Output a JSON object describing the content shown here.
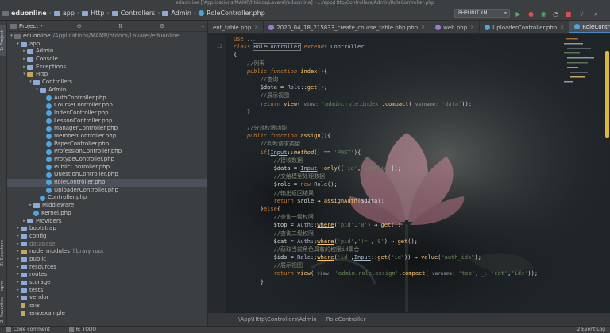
{
  "window": {
    "title": "eduonline [/Applications/MAMP/htdocs/Lavarel/eduonline] - .../app/Http/Controllers/Admin/RoleController.php"
  },
  "navbar": {
    "breadcrumbs": [
      "eduonline",
      "app",
      "Http",
      "Controllers",
      "Admin",
      "RoleController.php"
    ],
    "run_config": "PHPUNIT.XML"
  },
  "project_panel": {
    "title": "Project",
    "tree": [
      {
        "label": "eduonline",
        "path": "/Applications/MAMP/htdocs/Lavarel/eduonline",
        "type": "root"
      },
      {
        "label": "app",
        "type": "folder"
      },
      {
        "label": "Admin",
        "type": "folder"
      },
      {
        "label": "Console",
        "type": "folder"
      },
      {
        "label": "Exceptions",
        "type": "folder"
      },
      {
        "label": "Http",
        "type": "folder"
      },
      {
        "label": "Controllers",
        "type": "folder"
      },
      {
        "label": "Admin",
        "type": "folder"
      },
      {
        "label": "AuthController.php",
        "type": "php"
      },
      {
        "label": "CourseController.php",
        "type": "php"
      },
      {
        "label": "IndexController.php",
        "type": "php"
      },
      {
        "label": "LessonController.php",
        "type": "php"
      },
      {
        "label": "ManagerController.php",
        "type": "php"
      },
      {
        "label": "MemberController.php",
        "type": "php"
      },
      {
        "label": "PaperController.php",
        "type": "php"
      },
      {
        "label": "ProfessionController.php",
        "type": "php"
      },
      {
        "label": "ProtypeController.php",
        "type": "php"
      },
      {
        "label": "PublicController.php",
        "type": "php"
      },
      {
        "label": "QuestionController.php",
        "type": "php"
      },
      {
        "label": "RoleController.php",
        "type": "php"
      },
      {
        "label": "UploaderController.php",
        "type": "php"
      },
      {
        "label": "Controller.php",
        "type": "php"
      },
      {
        "label": "Middleware",
        "type": "folder"
      },
      {
        "label": "Kernel.php",
        "type": "php"
      },
      {
        "label": "Providers",
        "type": "folder"
      },
      {
        "label": "bootstrap",
        "type": "folder"
      },
      {
        "label": "config",
        "type": "folder"
      },
      {
        "label": "database",
        "type": "folder"
      },
      {
        "label": "node_modules",
        "suffix": "library root",
        "type": "folder"
      },
      {
        "label": "public",
        "type": "folder"
      },
      {
        "label": "resources",
        "type": "folder"
      },
      {
        "label": "routes",
        "type": "folder"
      },
      {
        "label": "storage",
        "type": "folder"
      },
      {
        "label": "tests",
        "type": "folder"
      },
      {
        "label": "vendor",
        "type": "folder"
      },
      {
        "label": ".env",
        "type": "env"
      },
      {
        "label": ".env.example",
        "type": "env"
      }
    ]
  },
  "side_tabs": {
    "project": "1: Project",
    "structure": "Z: Structure",
    "npm": "npm",
    "favorites": "2: Favorites"
  },
  "editor": {
    "tabs": [
      {
        "label": "ent_table.php",
        "active": false
      },
      {
        "label": "2020_04_18_215833_create_course_table.php.php",
        "active": false
      },
      {
        "label": "web.php",
        "active": false
      },
      {
        "label": "UploaderController.php",
        "active": false
      },
      {
        "label": "RoleController.php",
        "active": true
      }
    ],
    "line_number": "12",
    "breadcrumb": [
      "\\App\\Http\\Controllers\\Admin",
      "RoleController"
    ]
  },
  "status_bar": {
    "commit": "Code comment",
    "todo": "6: TODO",
    "event_log": "2 Event Log"
  },
  "colors": {
    "accent": "#4a88c7",
    "keyword": "#cc7832",
    "string": "#6a8759",
    "function": "#ffc66d",
    "scroll_thumb": "#e1b43a"
  }
}
